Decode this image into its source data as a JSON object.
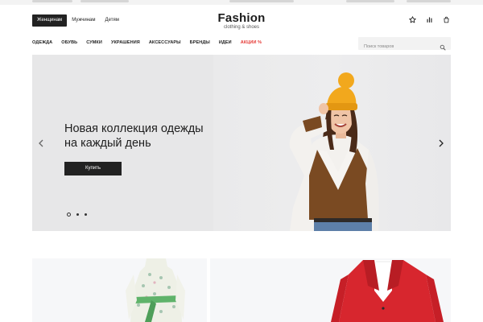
{
  "header": {
    "gender_tabs": [
      {
        "label": "Женщинам",
        "active": true
      },
      {
        "label": "Мужчинам",
        "active": false
      },
      {
        "label": "Детям",
        "active": false
      }
    ],
    "logo": {
      "title": "Fashion",
      "subtitle": "clothing & shoes"
    },
    "icons": [
      "star-icon",
      "chart-icon",
      "bag-icon"
    ]
  },
  "nav": {
    "items": [
      "ОДЕЖДА",
      "ОБУВЬ",
      "СУМКИ",
      "УКРАШЕНИЯ",
      "АКСЕССУАРЫ",
      "БРЕНДЫ",
      "ИДЕИ"
    ],
    "sale_label": "АКЦИИ %"
  },
  "search": {
    "placeholder": "Поиск товаров"
  },
  "hero": {
    "title_line1": "Новая коллекция одежды",
    "title_line2": "на каждый день",
    "button_label": "Купить",
    "slide_count": 3,
    "active_slide": 1
  },
  "colors": {
    "accent_dark": "#222222",
    "sale": "#e53935",
    "hero_bg": "#e9e9ea",
    "hat": "#f2a81d",
    "sweater_brown": "#7a4a22",
    "jacket_red": "#d7262e"
  }
}
